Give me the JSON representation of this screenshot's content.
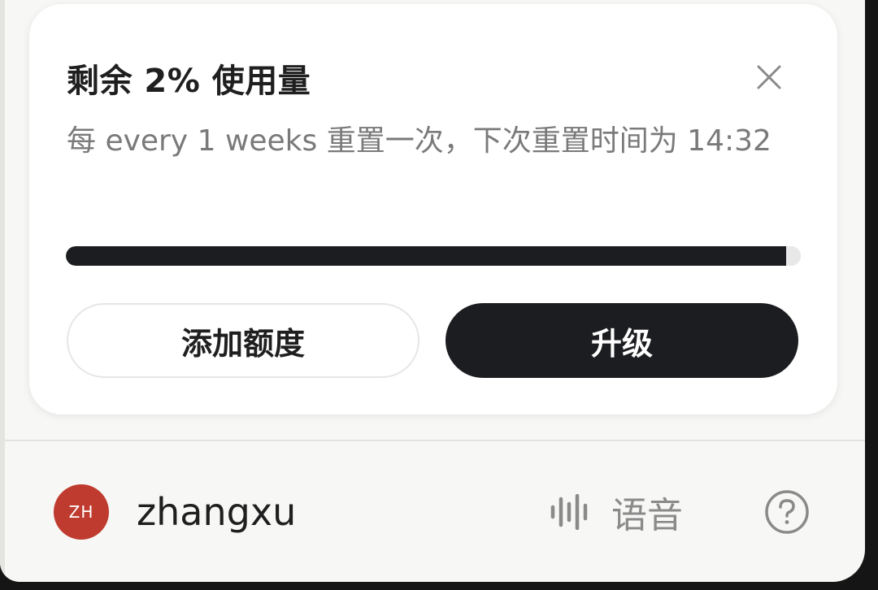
{
  "usage_popup": {
    "title": "剩余 2% 使用量",
    "subtitle": "每 every 1 weeks 重置一次，下次重置时间为 14:32",
    "remaining_fraction": 0.02,
    "add_quota_label": "添加额度",
    "upgrade_label": "升级"
  },
  "user_bar": {
    "avatar_initials": "ZH",
    "username": "zhangxu",
    "voice_label": "语音"
  },
  "colors": {
    "avatar_bg": "#bf3b2f",
    "primary_dark": "#1c1d20",
    "muted_text": "#7a7a7a"
  },
  "icons": [
    "close-icon",
    "voice-waveform-icon",
    "help-circle-icon"
  ]
}
